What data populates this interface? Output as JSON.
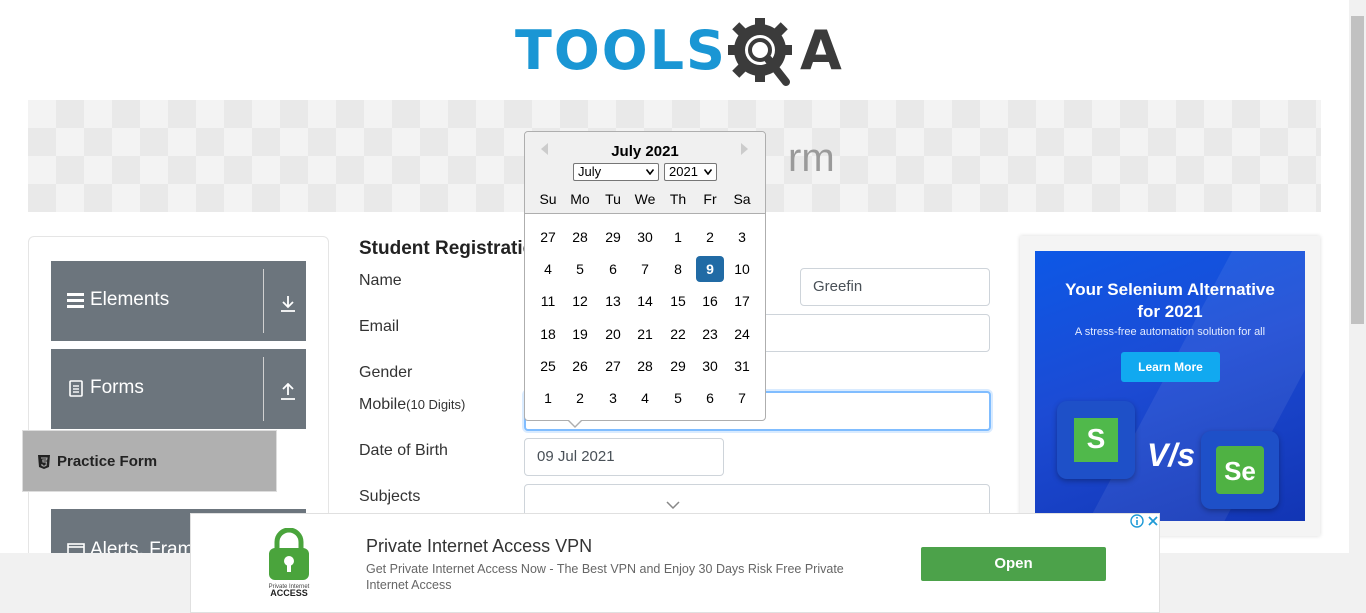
{
  "logo": {
    "text": "TOOLS",
    "letter_a": "A"
  },
  "banner": {
    "title": "rm"
  },
  "sidebar": {
    "groups": [
      {
        "label": "Elements"
      },
      {
        "label": "Forms"
      },
      {
        "label": "Alerts, Fram"
      }
    ],
    "active_item": {
      "label": "Practice Form"
    }
  },
  "form": {
    "title": "Student Registratio",
    "labels": {
      "name": "Name",
      "email": "Email",
      "gender": "Gender",
      "mobile": "Mobile",
      "mobile_hint": "(10 Digits)",
      "dob": "Date of Birth",
      "subjects": "Subjects"
    },
    "values": {
      "last_name": "Greefin",
      "dob": "09 Jul 2021"
    }
  },
  "datepicker": {
    "title": "July 2021",
    "month_select": "July",
    "year_select": "2021",
    "day_names": [
      "Su",
      "Mo",
      "Tu",
      "We",
      "Th",
      "Fr",
      "Sa"
    ],
    "weeks": [
      [
        "27",
        "28",
        "29",
        "30",
        "1",
        "2",
        "3"
      ],
      [
        "4",
        "5",
        "6",
        "7",
        "8",
        "9",
        "10"
      ],
      [
        "11",
        "12",
        "13",
        "14",
        "15",
        "16",
        "17"
      ],
      [
        "18",
        "19",
        "20",
        "21",
        "22",
        "23",
        "24"
      ],
      [
        "25",
        "26",
        "27",
        "28",
        "29",
        "30",
        "31"
      ],
      [
        "1",
        "2",
        "3",
        "4",
        "5",
        "6",
        "7"
      ]
    ],
    "selected_day": "9"
  },
  "ad_right": {
    "headline_1": "Your Selenium Alternative",
    "headline_2": "for 2021",
    "subtitle": "A stress-free automation solution for all",
    "button": "Learn More",
    "tile1_letter": "S",
    "vs": "V/s",
    "tile2_letters": "Se"
  },
  "ad_bottom": {
    "title": "Private Internet Access VPN",
    "description": "Get Private Internet Access Now - The Best VPN and Enjoy 30 Days Risk Free Private Internet Access",
    "button": "Open",
    "logo_caption_1": "Private Internet",
    "logo_caption_2": "ACCESS"
  },
  "colors": {
    "brand_blue": "#1a96d4",
    "sidebar_gray": "#6c757d",
    "selected_day": "#216ba5",
    "ad_green_button": "#4ca24a"
  }
}
